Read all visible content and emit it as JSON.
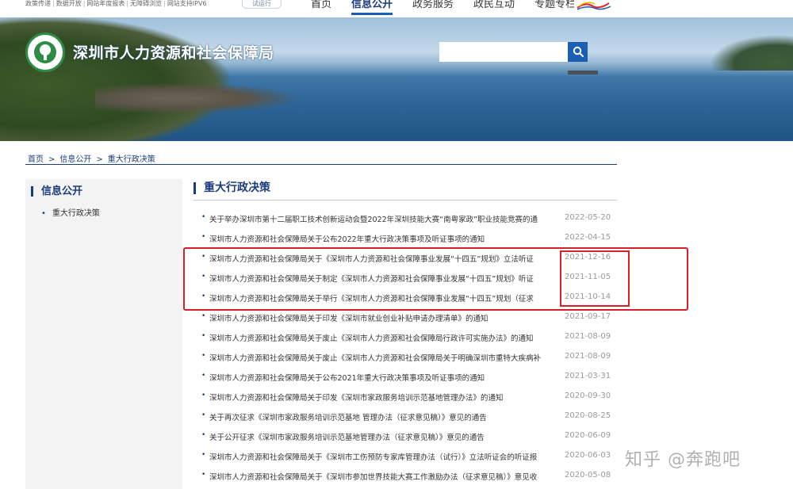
{
  "top_links": [
    "政策传递",
    "数据开放",
    "网站年度报表",
    "无障碍浏览",
    "网站支持IPV6"
  ],
  "trial_label": "试运行",
  "nav": [
    "首页",
    "信息公开",
    "政务服务",
    "政民互动",
    "专题专栏"
  ],
  "site_title": "深圳市人力资源和社会保障局",
  "search": {
    "placeholder": ""
  },
  "breadcrumb": [
    "首页",
    "信息公开",
    "重大行政决策"
  ],
  "sidebar": {
    "title": "信息公开",
    "items": [
      "重大行政决策"
    ]
  },
  "main": {
    "title": "重大行政决策",
    "items": [
      {
        "title": "关于举办深圳市第十二届职工技术创新运动会暨2022年深圳技能大赛“南粤家政”职业技能竞赛的通",
        "date": "2022-05-20"
      },
      {
        "title": "深圳市人力资源和社会保障局关于公布2022年重大行政决策事项及听证事项的通知",
        "date": "2022-04-15"
      },
      {
        "title": "深圳市人力资源和社会保障局关于《深圳市人力资源和社会保障事业发展“十四五”规划》立法听证",
        "date": "2021-12-16"
      },
      {
        "title": "深圳市人力资源和社会保障局关于制定《深圳市人力资源和社会保障事业发展“十四五”规划》听证",
        "date": "2021-11-05"
      },
      {
        "title": "深圳市人力资源和社会保障局关于举行《深圳市人力资源和社会保障事业发展“十四五”规划（征求",
        "date": "2021-10-14"
      },
      {
        "title": "深圳市人力资源和社会保障局关于印发《深圳市就业创业补贴申请办理清单》的通知",
        "date": "2021-09-17"
      },
      {
        "title": "深圳市人力资源和社会保障局关于废止《深圳市人力资源和社会保障局行政许可实施办法》的通知",
        "date": "2021-08-09"
      },
      {
        "title": "深圳市人力资源和社会保障局关于废止《深圳市人力资源和社会保障局关于明确深圳市重特大疾病补",
        "date": "2021-08-09"
      },
      {
        "title": "深圳市人力资源和社会保障局关于公布2021年重大行政决策事项及听证事项的通知",
        "date": "2021-03-31"
      },
      {
        "title": "深圳市人力资源和社会保障局关于印发《深圳市家政服务培训示范基地管理办法》的通知",
        "date": "2020-09-30"
      },
      {
        "title": "关于再次征求《深圳市家政服务培训示范基地 管理办法（征求意见稿）》意见的通告",
        "date": "2020-08-25"
      },
      {
        "title": "关于公开征求《深圳市家政服务培训示范基地管理办法（征求意见稿）》意见的通告",
        "date": "2020-06-09"
      },
      {
        "title": "深圳市人力资源和社会保障局关于《深圳市工伤预防专家库管理办法（试行）》立法听证会的听证报",
        "date": "2020-06-03"
      },
      {
        "title": "深圳市人力资源和社会保障局关于《深圳市参加世界技能大赛工作激励办法（征求意见稿）》意见收",
        "date": "2020-05-08"
      }
    ]
  },
  "watermark": "知乎 @奔跑吧",
  "colors": {
    "accent": "#1a3c7a",
    "search_button": "#1a5fb4",
    "annotation_red": "#d6202a"
  }
}
